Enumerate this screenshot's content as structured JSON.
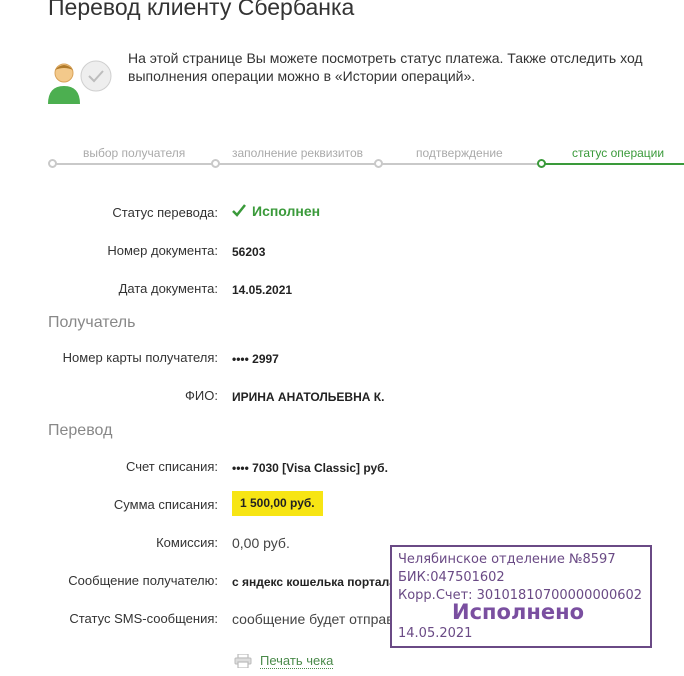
{
  "header": {
    "title": "Перевод клиенту Сбербанка"
  },
  "info": {
    "text": "На этой странице Вы можете посмотреть статус платежа. Также отследить ход выполнения операции можно в «Истории операций»."
  },
  "steps": [
    {
      "label": "выбор получателя"
    },
    {
      "label": "заполнение реквизитов"
    },
    {
      "label": "подтверждение"
    },
    {
      "label": "статус операции"
    }
  ],
  "details": {
    "status_label": "Статус перевода:",
    "status_value": "Исполнен",
    "doc_number_label": "Номер документа:",
    "doc_number_value": "56203",
    "doc_date_label": "Дата документа:",
    "doc_date_value": "14.05.2021"
  },
  "recipient": {
    "section_title": "Получатель",
    "card_label": "Номер карты получателя:",
    "card_value": "•••• 2997",
    "name_label": "ФИО:",
    "name_value": "ИРИНА АНАТОЛЬЕВНА К."
  },
  "transfer": {
    "section_title": "Перевод",
    "account_label": "Счет списания:",
    "account_value": "•••• 7030  [Visa Classic]  руб.",
    "amount_label": "Сумма списания:",
    "amount_value": "1 500,00  руб.",
    "fee_label": "Комиссия:",
    "fee_value": "0,00 руб.",
    "message_label": "Сообщение получателю:",
    "message_value": "с яндекс кошелька портала",
    "sms_label": "Статус SMS-сообщения:",
    "sms_value": "сообщение будет отправлено"
  },
  "actions": {
    "print_label": "Печать чека"
  },
  "stamp": {
    "line1": "Челябинское отделение №8597",
    "line2": "БИК:047501602",
    "line3": "Корр.Счет: 30101810700000000602",
    "big": "Исполнено",
    "date": "14.05.2021"
  },
  "colors": {
    "accent_green": "#3a9a3a",
    "highlight_yellow": "#f7e514",
    "stamp_purple": "#6a4a85"
  }
}
